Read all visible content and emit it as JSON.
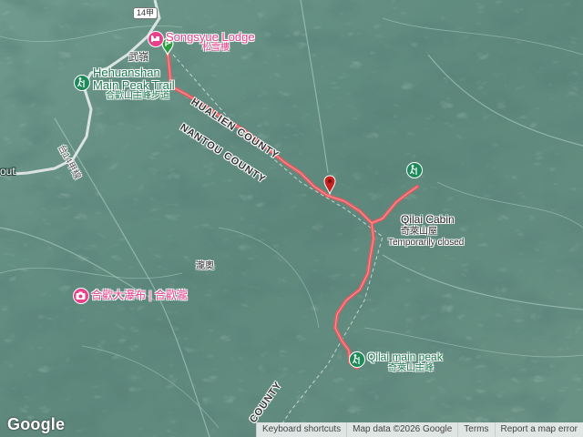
{
  "map": {
    "route_color": "#e95a60",
    "accent_pink": "#e8418c",
    "accent_green": "#1e8a5a",
    "terrain_color": "#5f8c7f"
  },
  "places": {
    "songsyue_lodge": {
      "name": "Songsyue Lodge",
      "name_zh": "松雪樓"
    },
    "hehuanshan": {
      "name_line1": "Hehuanshan",
      "name_line2": "Main Peak Trail",
      "name_zh": "合歡山主峰步道"
    },
    "qilai_cabin": {
      "name": "Qilai Cabin",
      "name_zh": "奇萊山屋",
      "status": "Temporarily closed"
    },
    "qilai_peak": {
      "name": "Qilai main peak",
      "name_zh": "奇萊山主峰"
    },
    "waterfall": {
      "name": "合歡大瀑布 | 合歡瀧"
    },
    "wuling": "武嶺",
    "taroko": "瀧奧",
    "road_vertical": "台14甲線",
    "lookout": "out"
  },
  "roads": {
    "shield": "14甲"
  },
  "counties": {
    "hualien": "HUALIEN COUNTY",
    "nantou": "NANTOU COUNTY",
    "bottom": "COUNTY"
  },
  "footer": {
    "logo": "Google",
    "keyboard": "Keyboard shortcuts",
    "mapdata": "Map data ©2026 Google",
    "terms": "Terms",
    "report": "Report a map error"
  }
}
